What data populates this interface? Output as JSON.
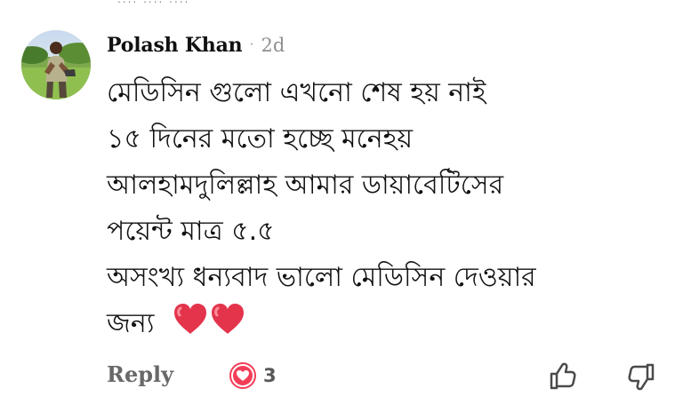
{
  "comment": {
    "author": "Polash Khan",
    "separator": "·",
    "time": "2d",
    "lines": [
      "মেডিসিন গুলো এখনো শেষ হয় নাই",
      "১৫ দিনের মতো হচ্ছে মনেহয়",
      "আলহামদুলিল্লাহ আমার ডায়াবেটিসের",
      "পয়েন্ট মাত্র ৫.৫",
      "অসংখ্য ধন্যবাদ ভালো মেডিসিন দেওয়ার",
      "জন্য"
    ]
  },
  "actions": {
    "reply_label": "Reply",
    "reaction_count": "3"
  },
  "colors": {
    "heart": "#e3344b",
    "reaction_heart": "#f33e58",
    "text": "#111111",
    "muted": "#8f8f8f",
    "action": "#686868"
  },
  "icons": {
    "reaction": "heart-icon",
    "like": "thumbs-up-icon",
    "dislike": "thumbs-down-icon"
  }
}
